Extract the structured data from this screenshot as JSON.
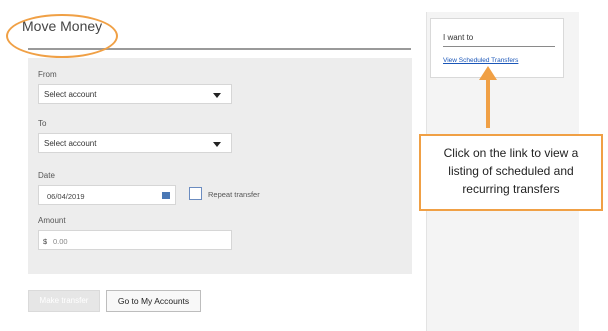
{
  "page": {
    "title": "Move Money"
  },
  "form": {
    "from_label": "From",
    "from_value": "Select account",
    "to_label": "To",
    "to_value": "Select account",
    "date_label": "Date",
    "date_value": "06/04/2019",
    "repeat_label": "Repeat transfer",
    "amount_label": "Amount",
    "amount_currency": "$",
    "amount_value": "0.00"
  },
  "actions": {
    "make_transfer": "Make transfer",
    "go_to_accounts": "Go to My Accounts"
  },
  "sidebar": {
    "title": "I want to",
    "link": "View Scheduled Transfers"
  },
  "callout": {
    "line1": "Click on the link to view a",
    "line2": "listing of scheduled and",
    "line3": "recurring transfers"
  },
  "colors": {
    "annotation": "#f0a045",
    "link": "#1a56b8"
  }
}
